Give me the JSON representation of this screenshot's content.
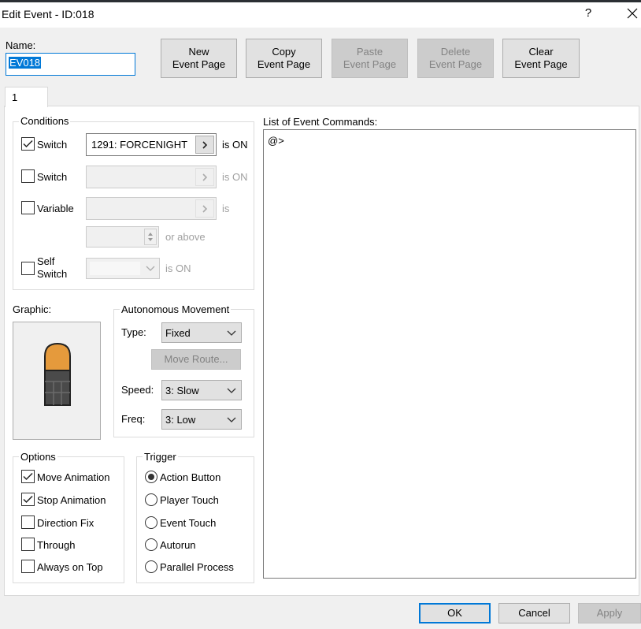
{
  "window": {
    "title": "Edit Event - ID:018",
    "help_label": "?",
    "close_label": "✕"
  },
  "name": {
    "label": "Name:",
    "value": "EV018"
  },
  "toolbar": {
    "new_page": [
      "New",
      "Event Page"
    ],
    "copy_page": [
      "Copy",
      "Event Page"
    ],
    "paste_page": [
      "Paste",
      "Event Page"
    ],
    "delete_page": [
      "Delete",
      "Event Page"
    ],
    "clear_page": [
      "Clear",
      "Event Page"
    ]
  },
  "tabs": [
    {
      "label": "1"
    }
  ],
  "conditions": {
    "title": "Conditions",
    "switch1": {
      "label": "Switch",
      "checked": true,
      "value": "1291: FORCENIGHT",
      "suffix": "is ON"
    },
    "switch2": {
      "label": "Switch",
      "checked": false,
      "value": "",
      "suffix": "is ON"
    },
    "variable": {
      "label": "Variable",
      "checked": false,
      "value": "",
      "suffix": "is",
      "amount_suffix": "or above"
    },
    "self_switch": {
      "label_line1": "Self",
      "label_line2": "Switch",
      "checked": false,
      "suffix": "is ON"
    }
  },
  "graphic": {
    "label": "Graphic:",
    "colors": {
      "body": "#e59a3c",
      "base": "#4a4a4a",
      "outline": "#222222"
    }
  },
  "movement": {
    "title": "Autonomous Movement",
    "type_label": "Type:",
    "type_value": "Fixed",
    "route_button": "Move Route...",
    "speed_label": "Speed:",
    "speed_value": "3: Slow",
    "freq_label": "Freq:",
    "freq_value": "3: Low"
  },
  "options": {
    "title": "Options",
    "items": [
      {
        "label": "Move Animation",
        "checked": true
      },
      {
        "label": "Stop Animation",
        "checked": true
      },
      {
        "label": "Direction Fix",
        "checked": false
      },
      {
        "label": "Through",
        "checked": false
      },
      {
        "label": "Always on Top",
        "checked": false
      }
    ]
  },
  "trigger": {
    "title": "Trigger",
    "items": [
      {
        "label": "Action Button",
        "selected": true
      },
      {
        "label": "Player Touch",
        "selected": false
      },
      {
        "label": "Event Touch",
        "selected": false
      },
      {
        "label": "Autorun",
        "selected": false
      },
      {
        "label": "Parallel Process",
        "selected": false
      }
    ]
  },
  "commands": {
    "label": "List of Event Commands:",
    "items": [
      "@>"
    ]
  },
  "footer": {
    "ok": "OK",
    "cancel": "Cancel",
    "apply": "Apply"
  }
}
